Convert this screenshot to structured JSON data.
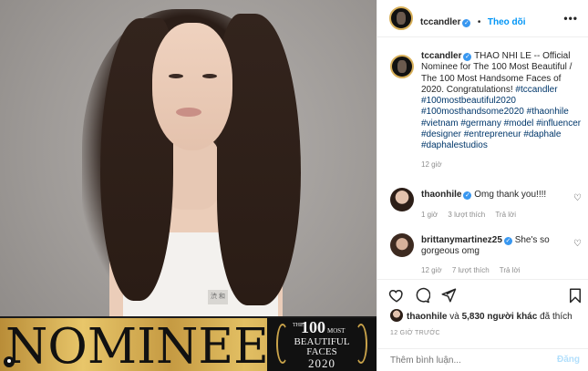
{
  "photo": {
    "banner_word": "NOMINEE",
    "badge_the": "THE",
    "badge_number": "100",
    "badge_most": "MOST",
    "badge_line1": "BEAUTIFUL",
    "badge_line2": "FACES",
    "badge_year": "2020",
    "dress_tag": "渋 和"
  },
  "header": {
    "username": "tccandler",
    "separator": "•",
    "follow_label": "Theo dõi",
    "more_label": "•••"
  },
  "caption": {
    "username": "tccandler",
    "text": "THAO NHI LE -- Official Nominee for The 100 Most Beautiful / The 100 Most Handsome Faces of 2020. Congratulations!",
    "hashtags": [
      "#tccandler",
      "#100mostbeautiful2020",
      "#100mosthandsome2020",
      "#thaonhile",
      "#vietnam",
      "#germany",
      "#model",
      "#influencer",
      "#designer",
      "#entrepreneur",
      "#daphale",
      "#daphalestudios"
    ],
    "time": "12 giờ"
  },
  "comments": [
    {
      "username": "thaonhile",
      "text": "Omg thank you!!!!",
      "time": "1 giờ",
      "likes": "3 lượt thích",
      "reply": "Trả lời"
    },
    {
      "username": "brittanymartinez25",
      "text": "She's so gorgeous omg",
      "time": "12 giờ",
      "likes": "7 lượt thích",
      "reply": "Trả lời"
    }
  ],
  "likes": {
    "user": "thaonhile",
    "middle": "và",
    "count": "5,830 người khác",
    "suffix": "đã thích"
  },
  "timestamp": "12 GIỜ TRƯỚC",
  "add_comment": {
    "placeholder": "Thêm bình luận...",
    "post_label": "Đăng"
  },
  "colors": {
    "link_blue": "#0095f6",
    "hashtag": "#00376b",
    "muted": "#8e8e8e",
    "verified": "#3897f0"
  }
}
